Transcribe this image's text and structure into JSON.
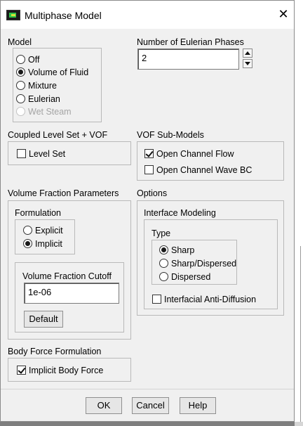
{
  "window": {
    "title": "Multiphase Model",
    "close": "✕"
  },
  "model": {
    "label": "Model",
    "options": [
      {
        "label": "Off",
        "selected": false,
        "enabled": true
      },
      {
        "label": "Volume of Fluid",
        "selected": true,
        "enabled": true
      },
      {
        "label": "Mixture",
        "selected": false,
        "enabled": true
      },
      {
        "label": "Eulerian",
        "selected": false,
        "enabled": true
      },
      {
        "label": "Wet Steam",
        "selected": false,
        "enabled": false
      }
    ]
  },
  "eulerian_phases": {
    "label": "Number of Eulerian Phases",
    "value": "2"
  },
  "coupled": {
    "label": "Coupled Level Set + VOF",
    "level_set": {
      "label": "Level Set",
      "checked": false
    }
  },
  "vof_sub_models": {
    "label": "VOF Sub-Models",
    "open_channel_flow": {
      "label": "Open Channel Flow",
      "checked": true
    },
    "open_channel_wave_bc": {
      "label": "Open Channel Wave BC",
      "checked": false
    }
  },
  "volume_fraction": {
    "label": "Volume Fraction Parameters",
    "formulation": {
      "label": "Formulation",
      "explicit": {
        "label": "Explicit",
        "selected": false
      },
      "implicit": {
        "label": "Implicit",
        "selected": true
      }
    },
    "cutoff": {
      "label": "Volume Fraction Cutoff",
      "value": "1e-06",
      "default_label": "Default"
    }
  },
  "options": {
    "label": "Options",
    "interface_modeling": {
      "label": "Interface Modeling",
      "type": {
        "label": "Type",
        "sharp": {
          "label": "Sharp",
          "selected": true
        },
        "sharp_dispersed": {
          "label": "Sharp/Dispersed",
          "selected": false
        },
        "dispersed": {
          "label": "Dispersed",
          "selected": false
        }
      },
      "anti_diffusion": {
        "label": "Interfacial Anti-Diffusion",
        "checked": false
      }
    }
  },
  "body_force": {
    "label": "Body Force Formulation",
    "implicit": {
      "label": "Implicit Body Force",
      "checked": true
    }
  },
  "buttons": {
    "ok": "OK",
    "cancel": "Cancel",
    "help": "Help"
  }
}
